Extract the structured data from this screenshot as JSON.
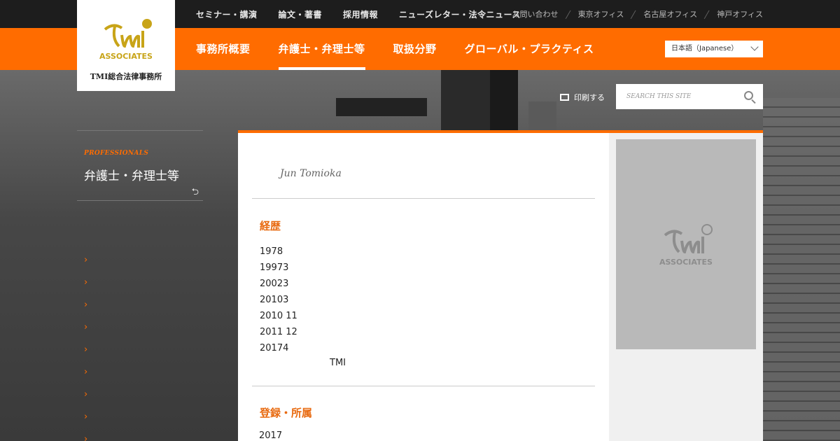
{
  "top_nav": [
    "セミナー・講演",
    "論文・著書",
    "採用情報",
    "ニューズレター・法令ニュース"
  ],
  "top_links": [
    "お問い合わせ",
    "東京オフィス",
    "名古屋オフィス",
    "神戸オフィス"
  ],
  "main_nav": [
    "事務所概要",
    "弁護士・弁理士等",
    "取扱分野",
    "グローバル・プラクティス"
  ],
  "language": "日本語（Japanese）",
  "logo": {
    "mark_text": "ASSOCIATES",
    "name": "TMI総合法律事務所"
  },
  "print_label": "印刷する",
  "search": {
    "placeholder": "SEARCH THIS SITE"
  },
  "sidebar": {
    "section_en": "PROFESSIONALS",
    "section_jp": "弁護士・弁理士等",
    "back_icon": "return-arrow-icon",
    "items": [
      "›",
      "›",
      "›",
      "›",
      "›",
      "›",
      "›",
      "›",
      "›"
    ]
  },
  "profile": {
    "name_en": "Jun Tomioka",
    "career_heading": "経歴",
    "career": [
      "1978",
      "19973",
      "20023",
      "20103",
      "2010 11",
      "2011 12",
      "20174",
      "TMI"
    ],
    "registration_heading": "登録・所属",
    "registration": [
      "2017"
    ]
  },
  "colors": {
    "accent": "#ff6c00",
    "heading": "#e86a10",
    "topbar": "#1d1d1d"
  }
}
